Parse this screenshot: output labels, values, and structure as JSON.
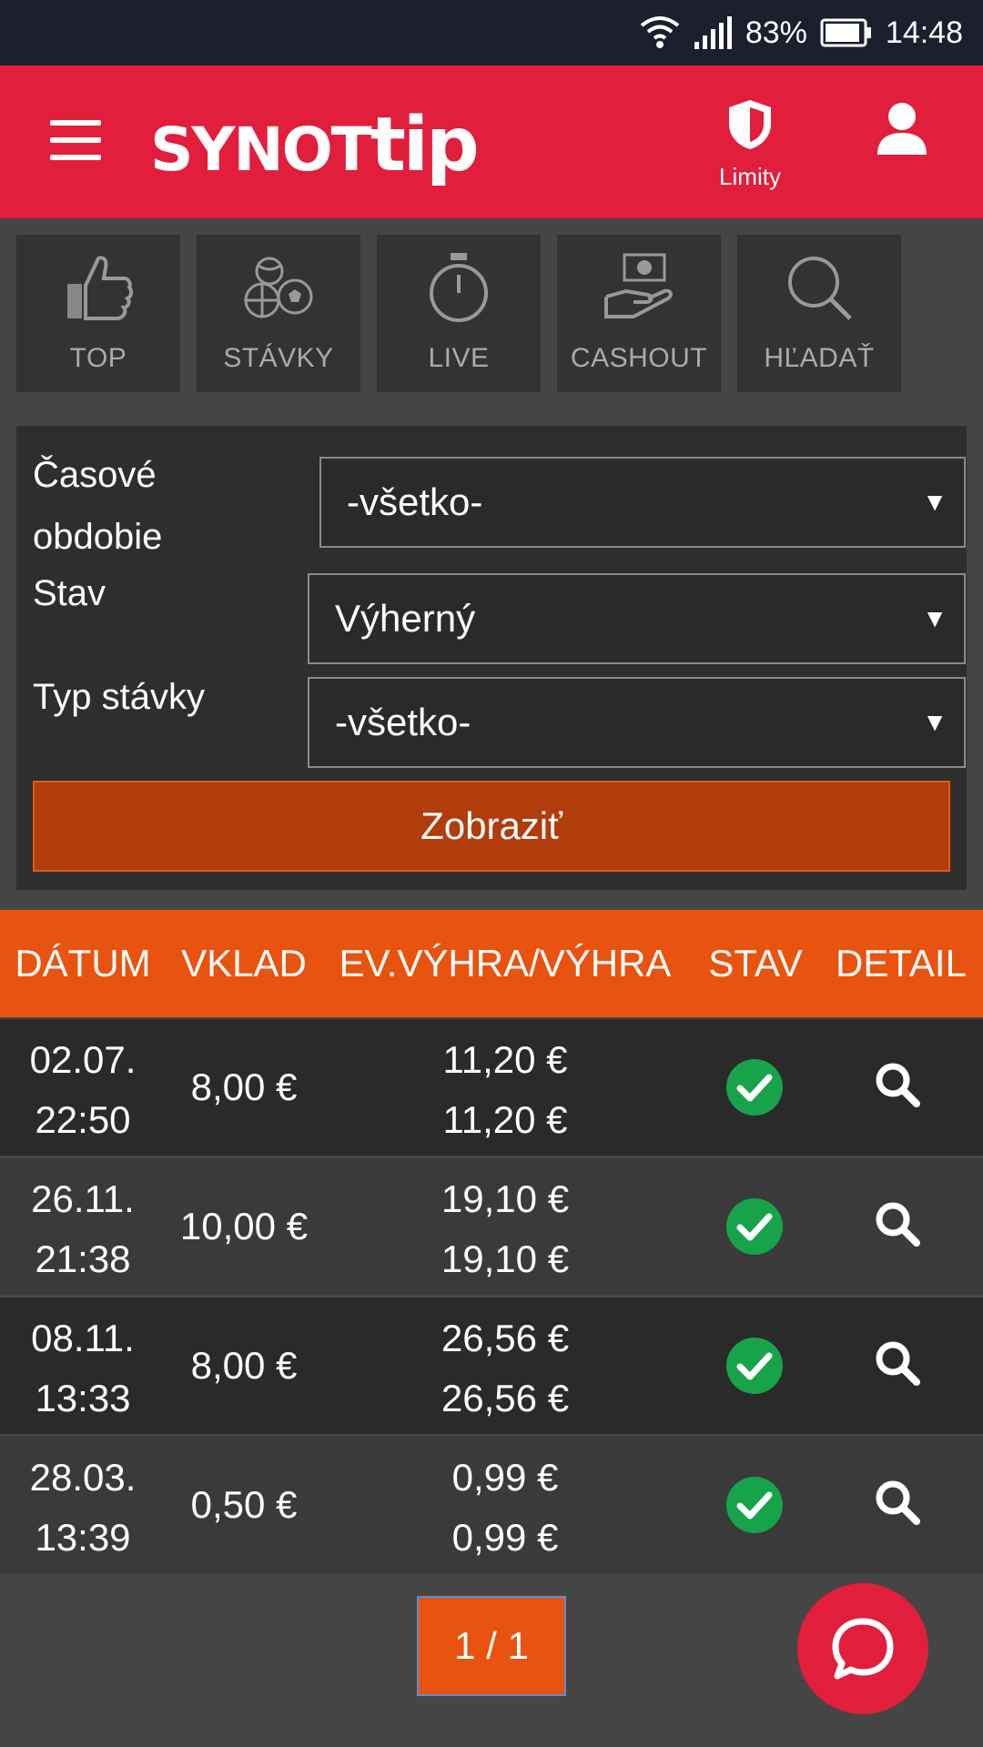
{
  "status_bar": {
    "battery": "83%",
    "time": "14:48"
  },
  "header": {
    "logo_a": "SYNOT",
    "logo_b": "tip",
    "limits_label": "Limity"
  },
  "tiles": [
    {
      "label": "TOP",
      "icon": "thumbs-up-icon"
    },
    {
      "label": "STÁVKY",
      "icon": "sports-balls-icon"
    },
    {
      "label": "LIVE",
      "icon": "stopwatch-icon"
    },
    {
      "label": "CASHOUT",
      "icon": "cash-hand-icon"
    },
    {
      "label": "HĽADAŤ",
      "icon": "search-icon"
    }
  ],
  "filter": {
    "period_label_1": "Časové",
    "period_label_2": "obdobie",
    "period_value": "-všetko-",
    "state_label": "Stav",
    "state_value": "Výherný",
    "type_label": "Typ stávky",
    "type_value": "-všetko-",
    "show_button": "Zobraziť"
  },
  "table": {
    "headers": {
      "date": "DÁTUM",
      "stake": "VKLAD",
      "win": "EV.VÝHRA/VÝHRA",
      "state": "STAV",
      "detail": "DETAIL"
    },
    "rows": [
      {
        "date": "02.07.",
        "time": "22:50",
        "stake": "8,00 €",
        "ev_win": "11,20 €",
        "win": "11,20 €"
      },
      {
        "date": "26.11.",
        "time": "21:38",
        "stake": "10,00 €",
        "ev_win": "19,10 €",
        "win": "19,10 €"
      },
      {
        "date": "08.11.",
        "time": "13:33",
        "stake": "8,00 €",
        "ev_win": "26,56 €",
        "win": "26,56 €"
      },
      {
        "date": "28.03.",
        "time": "13:39",
        "stake": "0,50 €",
        "ev_win": "0,99 €",
        "win": "0,99 €"
      }
    ]
  },
  "pager": "1 / 1",
  "colors": {
    "brand_red": "#e11e3c",
    "orange": "#e8530f",
    "success_green": "#17a34a"
  }
}
